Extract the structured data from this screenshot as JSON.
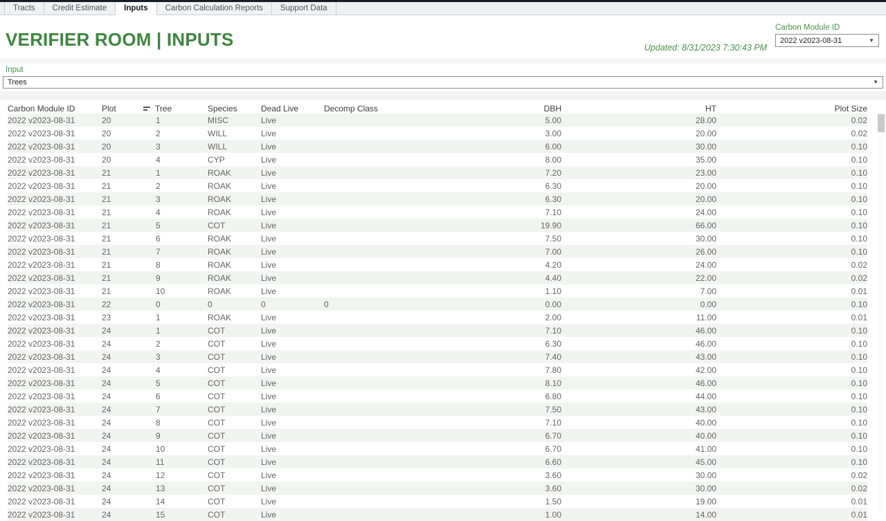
{
  "topbar": {
    "tabs": [
      {
        "label": "Tracts"
      },
      {
        "label": "Credit Estimate"
      },
      {
        "label": "Inputs"
      },
      {
        "label": "Carbon Calculation Reports"
      },
      {
        "label": "Support Data"
      }
    ],
    "active_tab": "Inputs"
  },
  "header": {
    "title": "VERIFIER ROOM | INPUTS",
    "updated": "Updated: 8/31/2023 7:30:43 PM",
    "module_label": "Carbon Module ID",
    "module_value": "2022 v2023-08-31"
  },
  "filter": {
    "label": "Input",
    "value": "Trees"
  },
  "icons": {
    "dropdown_arrow": "▼",
    "sort": "sort-descending-icon"
  },
  "table": {
    "columns": [
      {
        "label": "Carbon Module ID",
        "align": "left",
        "sorted": false
      },
      {
        "label": "Plot",
        "align": "left",
        "sorted": false
      },
      {
        "label": "Tree",
        "align": "left",
        "sorted": true
      },
      {
        "label": "Species",
        "align": "left",
        "sorted": false
      },
      {
        "label": "Dead Live",
        "align": "left",
        "sorted": false
      },
      {
        "label": "Decomp Class",
        "align": "left",
        "sorted": false
      },
      {
        "label": "DBH",
        "align": "right",
        "sorted": false
      },
      {
        "label": "HT",
        "align": "right",
        "sorted": false
      },
      {
        "label": "Plot Size",
        "align": "right",
        "sorted": false
      }
    ],
    "rows": [
      [
        "2022 v2023-08-31",
        "20",
        "1",
        "MISC",
        "Live",
        "",
        "5.00",
        "28.00",
        "0.02"
      ],
      [
        "2022 v2023-08-31",
        "20",
        "2",
        "WILL",
        "Live",
        "",
        "3.00",
        "20.00",
        "0.02"
      ],
      [
        "2022 v2023-08-31",
        "20",
        "3",
        "WILL",
        "Live",
        "",
        "6.00",
        "30.00",
        "0.10"
      ],
      [
        "2022 v2023-08-31",
        "20",
        "4",
        "CYP",
        "Live",
        "",
        "8.00",
        "35.00",
        "0.10"
      ],
      [
        "2022 v2023-08-31",
        "21",
        "1",
        "ROAK",
        "Live",
        "",
        "7.20",
        "23.00",
        "0.10"
      ],
      [
        "2022 v2023-08-31",
        "21",
        "2",
        "ROAK",
        "Live",
        "",
        "6.30",
        "20.00",
        "0.10"
      ],
      [
        "2022 v2023-08-31",
        "21",
        "3",
        "ROAK",
        "Live",
        "",
        "6.30",
        "20.00",
        "0.10"
      ],
      [
        "2022 v2023-08-31",
        "21",
        "4",
        "ROAK",
        "Live",
        "",
        "7.10",
        "24.00",
        "0.10"
      ],
      [
        "2022 v2023-08-31",
        "21",
        "5",
        "COT",
        "Live",
        "",
        "19.90",
        "66.00",
        "0.10"
      ],
      [
        "2022 v2023-08-31",
        "21",
        "6",
        "ROAK",
        "Live",
        "",
        "7.50",
        "30.00",
        "0.10"
      ],
      [
        "2022 v2023-08-31",
        "21",
        "7",
        "ROAK",
        "Live",
        "",
        "7.00",
        "26.00",
        "0.10"
      ],
      [
        "2022 v2023-08-31",
        "21",
        "8",
        "ROAK",
        "Live",
        "",
        "4.20",
        "24.00",
        "0.02"
      ],
      [
        "2022 v2023-08-31",
        "21",
        "9",
        "ROAK",
        "Live",
        "",
        "4.40",
        "22.00",
        "0.02"
      ],
      [
        "2022 v2023-08-31",
        "21",
        "10",
        "ROAK",
        "Live",
        "",
        "1.10",
        "7.00",
        "0.01"
      ],
      [
        "2022 v2023-08-31",
        "22",
        "0",
        "0",
        "0",
        "0",
        "0.00",
        "0.00",
        "0.10"
      ],
      [
        "2022 v2023-08-31",
        "23",
        "1",
        "ROAK",
        "Live",
        "",
        "2.00",
        "11.00",
        "0.01"
      ],
      [
        "2022 v2023-08-31",
        "24",
        "1",
        "COT",
        "Live",
        "",
        "7.10",
        "46.00",
        "0.10"
      ],
      [
        "2022 v2023-08-31",
        "24",
        "2",
        "COT",
        "Live",
        "",
        "6.30",
        "46.00",
        "0.10"
      ],
      [
        "2022 v2023-08-31",
        "24",
        "3",
        "COT",
        "Live",
        "",
        "7.40",
        "43.00",
        "0.10"
      ],
      [
        "2022 v2023-08-31",
        "24",
        "4",
        "COT",
        "Live",
        "",
        "7.80",
        "42.00",
        "0.10"
      ],
      [
        "2022 v2023-08-31",
        "24",
        "5",
        "COT",
        "Live",
        "",
        "8.10",
        "46.00",
        "0.10"
      ],
      [
        "2022 v2023-08-31",
        "24",
        "6",
        "COT",
        "Live",
        "",
        "6.80",
        "44.00",
        "0.10"
      ],
      [
        "2022 v2023-08-31",
        "24",
        "7",
        "COT",
        "Live",
        "",
        "7.50",
        "43.00",
        "0.10"
      ],
      [
        "2022 v2023-08-31",
        "24",
        "8",
        "COT",
        "Live",
        "",
        "7.10",
        "40.00",
        "0.10"
      ],
      [
        "2022 v2023-08-31",
        "24",
        "9",
        "COT",
        "Live",
        "",
        "6.70",
        "40.00",
        "0.10"
      ],
      [
        "2022 v2023-08-31",
        "24",
        "10",
        "COT",
        "Live",
        "",
        "6.70",
        "41.00",
        "0.10"
      ],
      [
        "2022 v2023-08-31",
        "24",
        "11",
        "COT",
        "Live",
        "",
        "6.60",
        "45.00",
        "0.10"
      ],
      [
        "2022 v2023-08-31",
        "24",
        "12",
        "COT",
        "Live",
        "",
        "3.60",
        "30.00",
        "0.02"
      ],
      [
        "2022 v2023-08-31",
        "24",
        "13",
        "COT",
        "Live",
        "",
        "3.60",
        "30.00",
        "0.02"
      ],
      [
        "2022 v2023-08-31",
        "24",
        "14",
        "COT",
        "Live",
        "",
        "1.50",
        "19.00",
        "0.01"
      ],
      [
        "2022 v2023-08-31",
        "24",
        "15",
        "COT",
        "Live",
        "",
        "1.00",
        "14.00",
        "0.01"
      ]
    ]
  },
  "colors": {
    "accent_green": "#3f8440",
    "label_green": "#4a9048",
    "row_stripe": "#f0f5f0",
    "topbar_dark": "#161d27"
  }
}
